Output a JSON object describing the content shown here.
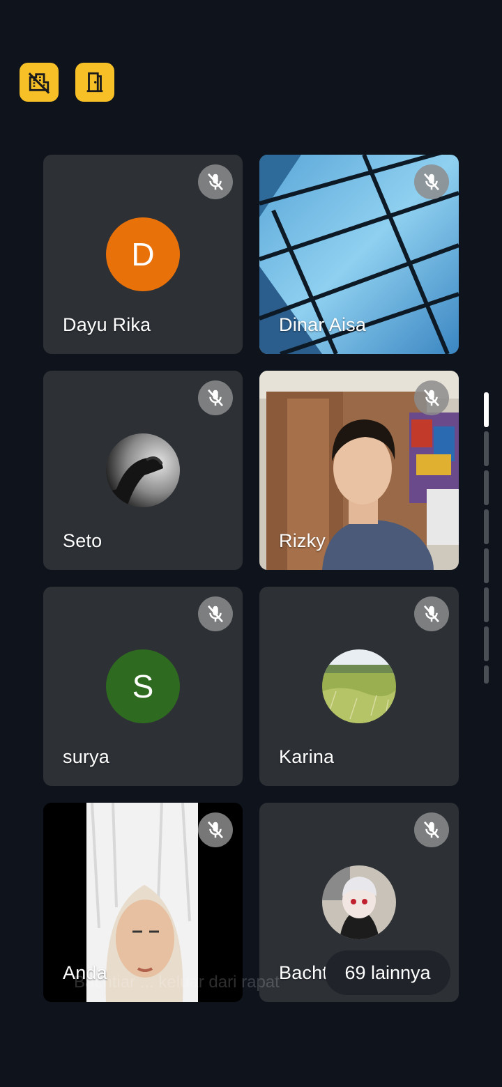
{
  "toolbar": {
    "left_icon": "camera-off-building-icon",
    "right_icon": "door-exit-icon",
    "accent": "#f6c026"
  },
  "participants": [
    {
      "name": "Dayu Rika",
      "initial": "D",
      "avatar_color": "#e8710a",
      "muted": true
    },
    {
      "name": "Dinar Aisa",
      "muted": true
    },
    {
      "name": "Seto",
      "muted": true
    },
    {
      "name": "Rizky",
      "muted": true
    },
    {
      "name": "surya",
      "initial": "S",
      "avatar_color": "#2e6a1f",
      "muted": true
    },
    {
      "name": "Karina",
      "muted": true
    },
    {
      "name": "Anda",
      "muted": true
    },
    {
      "name": "Bachtia",
      "muted": true
    }
  ],
  "more": {
    "label": "69 lainnya"
  },
  "toast": {
    "text": "Bachtiar ... keluar dari rapat"
  }
}
